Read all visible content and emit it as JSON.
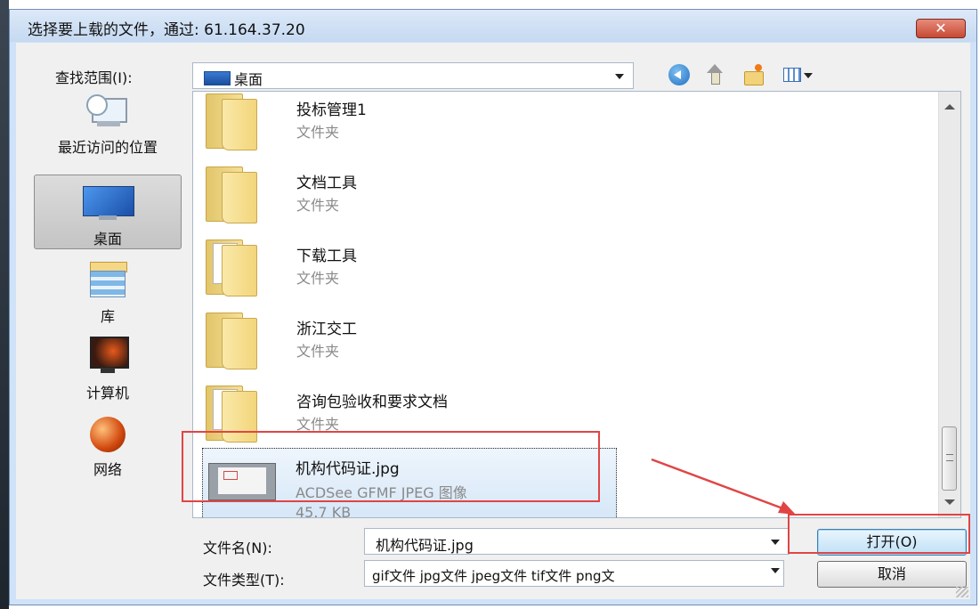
{
  "window": {
    "title": "选择要上载的文件，通过: 61.164.37.20",
    "close_glyph": "✕"
  },
  "toolbar": {
    "lookin_label": "查找范围(I):",
    "lookin_value": "桌面"
  },
  "places": [
    {
      "label": "最近访问的位置",
      "icon": "recent-places-icon"
    },
    {
      "label": "桌面",
      "icon": "desktop-icon",
      "selected": true
    },
    {
      "label": "库",
      "icon": "libraries-icon"
    },
    {
      "label": "计算机",
      "icon": "computer-icon"
    },
    {
      "label": "网络",
      "icon": "network-icon"
    }
  ],
  "files": [
    {
      "name": "投标管理1",
      "type": "文件夹"
    },
    {
      "name": "文档工具",
      "type": "文件夹"
    },
    {
      "name": "下载工具",
      "type": "文件夹"
    },
    {
      "name": "浙江交工",
      "type": "文件夹"
    },
    {
      "name": "咨询包验收和要求文档",
      "type": "文件夹"
    },
    {
      "name": "机构代码证.jpg",
      "type": "ACDSee GFMF JPEG 图像",
      "size": "45.7 KB",
      "selected": true
    }
  ],
  "bottom": {
    "filename_label": "文件名(N):",
    "filename_value": "机构代码证.jpg",
    "filetype_label": "文件类型(T):",
    "filetype_value": "gif文件 jpg文件 jpeg文件 tif文件 png文",
    "open_button": "打开(O)",
    "cancel_button": "取消"
  },
  "annotation_color": "#e04545"
}
